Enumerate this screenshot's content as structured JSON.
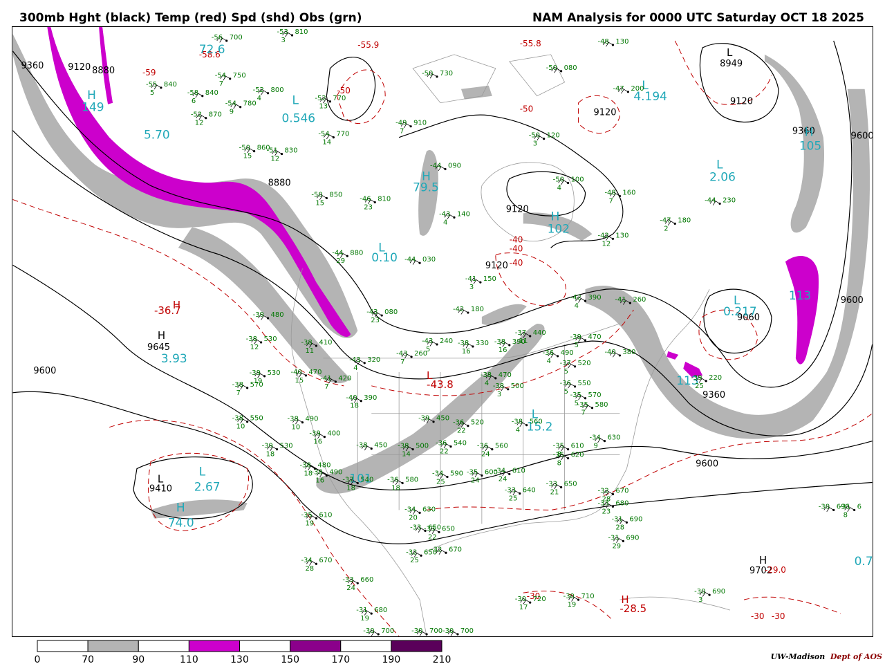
{
  "header": {
    "left_title": "300mb Hght (black) Temp (red) Spd (shd) Obs (grn)",
    "right_title": "NAM Analysis for 0000 UTC Saturday  OCT 18 2025"
  },
  "colors": {
    "height": "#000000",
    "temp": "#c00000",
    "obs": "#007700",
    "speed_label": "#20a8b8",
    "shade_70": "#b4b4b4",
    "shade_110": "#cc00cc",
    "shade_150": "#8b008b",
    "shade_190": "#5a005a",
    "coast": "#9a9a9a"
  },
  "legend": {
    "ticks": [
      "0",
      "70",
      "90",
      "110",
      "130",
      "150",
      "170",
      "190",
      "210"
    ],
    "segments": [
      {
        "from": "0",
        "to": "70",
        "color": "#ffffff"
      },
      {
        "from": "70",
        "to": "90",
        "color": "#b4b4b4"
      },
      {
        "from": "90",
        "to": "110",
        "color": "#ffffff"
      },
      {
        "from": "110",
        "to": "130",
        "color": "#cc00cc"
      },
      {
        "from": "130",
        "to": "150",
        "color": "#ffffff"
      },
      {
        "from": "150",
        "to": "170",
        "color": "#8b008b"
      },
      {
        "from": "170",
        "to": "190",
        "color": "#ffffff"
      },
      {
        "from": "190",
        "to": "210",
        "color": "#5a005a"
      }
    ]
  },
  "credit": {
    "part1": "UW-Madison",
    "part2": "Dept of AOS"
  },
  "height_labels": [
    "9360",
    "9120",
    "8880",
    "9120",
    "8880",
    "8949",
    "9120",
    "9360",
    "9600",
    "9120",
    "9120",
    "9360",
    "9060",
    "9360",
    "9600",
    "9645",
    "9600",
    "9410",
    "9600",
    "9702"
  ],
  "pressure_centers": [
    {
      "letter": "H",
      "value": "149",
      "kind": "speed"
    },
    {
      "letter": "L",
      "value": "0.546",
      "kind": "speed"
    },
    {
      "letter": "H",
      "value": "79.5",
      "kind": "speed"
    },
    {
      "letter": "L",
      "value": "0.10",
      "kind": "speed"
    },
    {
      "letter": "H",
      "value": "102",
      "kind": "speed"
    },
    {
      "letter": "L",
      "value": "2.06",
      "kind": "speed"
    },
    {
      "letter": "L",
      "value": "4.194",
      "kind": "speed"
    },
    {
      "letter": "H",
      "value": "105",
      "kind": "speed"
    },
    {
      "letter": "L",
      "value": "0.217",
      "kind": "speed"
    },
    {
      "letter": "H",
      "value": "113",
      "kind": "speed"
    },
    {
      "letter": "H",
      "value": "3.93",
      "kind": "speed"
    },
    {
      "letter": "L",
      "value": "2.67",
      "kind": "speed"
    },
    {
      "letter": "H",
      "value": "74.0",
      "kind": "speed"
    },
    {
      "letter": "H",
      "value": "101",
      "kind": "speed"
    },
    {
      "letter": "L",
      "value": "15.2",
      "kind": "speed"
    },
    {
      "letter": "H",
      "value": "-36.7",
      "kind": "temp"
    },
    {
      "letter": "L",
      "value": "-43.8",
      "kind": "temp"
    },
    {
      "letter": "H",
      "value": "-28.5",
      "kind": "temp"
    },
    {
      "letter": "H",
      "value": "",
      "kind": "height"
    },
    {
      "letter": "L",
      "value": "",
      "kind": "height"
    }
  ],
  "temp_labels": [
    "-58.6",
    "-55.9",
    "-55.8",
    "-59",
    "-50",
    "-50",
    "-40",
    "-40",
    "-40",
    "-30",
    "-30",
    "-30",
    "-29.0",
    "-50",
    "-40"
  ],
  "obs": [
    {
      "t": "-53",
      "h": "810",
      "d": "3"
    },
    {
      "t": "-56",
      "h": "700",
      "d": ""
    },
    {
      "t": "-54",
      "h": "750",
      "d": "7"
    },
    {
      "t": "-55",
      "h": "840",
      "d": "5"
    },
    {
      "t": "-58",
      "h": "840",
      "d": "6"
    },
    {
      "t": "-52",
      "h": "800",
      "d": "4"
    },
    {
      "t": "-54",
      "h": "780",
      "d": "9"
    },
    {
      "t": "-52",
      "h": "870",
      "d": "12"
    },
    {
      "t": "-52",
      "h": "770",
      "d": "13"
    },
    {
      "t": "-54",
      "h": "770",
      "d": "14"
    },
    {
      "t": "-49",
      "h": "910",
      "d": "7"
    },
    {
      "t": "-50",
      "h": "730",
      "d": ""
    },
    {
      "t": "-50",
      "h": "080",
      "d": ""
    },
    {
      "t": "-48",
      "h": "130",
      "d": ""
    },
    {
      "t": "-47",
      "h": "200",
      "d": ""
    },
    {
      "t": "-50",
      "h": "860",
      "d": "15"
    },
    {
      "t": "-51",
      "h": "830",
      "d": "12"
    },
    {
      "t": "-44",
      "h": "090",
      "d": ""
    },
    {
      "t": "-50",
      "h": "120",
      "d": "3"
    },
    {
      "t": "-50",
      "h": "100",
      "d": "4"
    },
    {
      "t": "-48",
      "h": "160",
      "d": "7"
    },
    {
      "t": "-44",
      "h": "230",
      "d": ""
    },
    {
      "t": "-50",
      "h": "850",
      "d": "15"
    },
    {
      "t": "-46",
      "h": "810",
      "d": "23"
    },
    {
      "t": "-43",
      "h": "140",
      "d": "4"
    },
    {
      "t": "-47",
      "h": "180",
      "d": "2"
    },
    {
      "t": "-42",
      "h": "130",
      "d": "12"
    },
    {
      "t": "-44",
      "h": "880",
      "d": "29"
    },
    {
      "t": "-44",
      "h": "030",
      "d": ""
    },
    {
      "t": "-41",
      "h": "150",
      "d": "3"
    },
    {
      "t": "-42",
      "h": "180",
      "d": ""
    },
    {
      "t": "-41",
      "h": "260",
      "d": ""
    },
    {
      "t": "-42",
      "h": "390",
      "d": "4"
    },
    {
      "t": "-43",
      "h": "080",
      "d": "23"
    },
    {
      "t": "-43",
      "h": "240",
      "d": "5"
    },
    {
      "t": "-38",
      "h": "330",
      "d": "16"
    },
    {
      "t": "-38",
      "h": "390",
      "d": "16"
    },
    {
      "t": "-37",
      "h": "440",
      "d": "11"
    },
    {
      "t": "-39",
      "h": "470",
      "d": "5"
    },
    {
      "t": "-39",
      "h": "480",
      "d": ""
    },
    {
      "t": "-38",
      "h": "530",
      "d": "12"
    },
    {
      "t": "-38",
      "h": "410",
      "d": "11"
    },
    {
      "t": "-43",
      "h": "320",
      "d": "4"
    },
    {
      "t": "-43",
      "h": "260",
      "d": "7"
    },
    {
      "t": "-39",
      "h": "530",
      "d": "19"
    },
    {
      "t": "-40",
      "h": "470",
      "d": "15"
    },
    {
      "t": "-41",
      "h": "420",
      "d": "7"
    },
    {
      "t": "-38",
      "h": "570",
      "d": "7"
    },
    {
      "t": "-40",
      "h": "390",
      "d": "18"
    },
    {
      "t": "-38",
      "h": "470",
      "d": "4"
    },
    {
      "t": "-38",
      "h": "500",
      "d": "3"
    },
    {
      "t": "-36",
      "h": "490",
      "d": "4"
    },
    {
      "t": "-37",
      "h": "520",
      "d": "5"
    },
    {
      "t": "-36",
      "h": "550",
      "d": "5"
    },
    {
      "t": "-35",
      "h": "570",
      "d": "5"
    },
    {
      "t": "-35",
      "h": "580",
      "d": "7"
    },
    {
      "t": "-38",
      "h": "550",
      "d": "10"
    },
    {
      "t": "-38",
      "h": "490",
      "d": "10"
    },
    {
      "t": "-39",
      "h": "400",
      "d": "16"
    },
    {
      "t": "-38",
      "h": "480",
      "d": "18"
    },
    {
      "t": "-39",
      "h": "450",
      "d": ""
    },
    {
      "t": "-36",
      "h": "520",
      "d": "22"
    },
    {
      "t": "-38",
      "h": "560",
      "d": "4"
    },
    {
      "t": "-39",
      "h": "530",
      "d": "18"
    },
    {
      "t": "-38",
      "h": "450",
      "d": ""
    },
    {
      "t": "-38",
      "h": "500",
      "d": "14"
    },
    {
      "t": "-36",
      "h": "540",
      "d": "22"
    },
    {
      "t": "-36",
      "h": "560",
      "d": "24"
    },
    {
      "t": "-35",
      "h": "610",
      "d": "8"
    },
    {
      "t": "-35",
      "h": "620",
      "d": "8"
    },
    {
      "t": "-34",
      "h": "630",
      "d": "9"
    },
    {
      "t": "-38",
      "h": "490",
      "d": "16"
    },
    {
      "t": "-37",
      "h": "540",
      "d": "18"
    },
    {
      "t": "-36",
      "h": "580",
      "d": "18"
    },
    {
      "t": "-34",
      "h": "590",
      "d": "25"
    },
    {
      "t": "-35",
      "h": "600",
      "d": "24"
    },
    {
      "t": "-34",
      "h": "610",
      "d": "24"
    },
    {
      "t": "-33",
      "h": "650",
      "d": "21"
    },
    {
      "t": "-33",
      "h": "640",
      "d": "25"
    },
    {
      "t": "-33",
      "h": "650",
      "d": ""
    },
    {
      "t": "-32",
      "h": "670",
      "d": "28"
    },
    {
      "t": "-33",
      "h": "680",
      "d": "23"
    },
    {
      "t": "-31",
      "h": "690",
      "d": "28"
    },
    {
      "t": "-31",
      "h": "690",
      "d": "29"
    },
    {
      "t": "-35",
      "h": "610",
      "d": "19"
    },
    {
      "t": "-34",
      "h": "630",
      "d": "20"
    },
    {
      "t": "-33",
      "h": "650",
      "d": "22"
    },
    {
      "t": "-32",
      "h": "650",
      "d": "25"
    },
    {
      "t": "-32",
      "h": "670",
      "d": ""
    },
    {
      "t": "-34",
      "h": "670",
      "d": "28"
    },
    {
      "t": "-33",
      "h": "660",
      "d": "24"
    },
    {
      "t": "-31",
      "h": "680",
      "d": "19"
    },
    {
      "t": "-30",
      "h": "700",
      "d": "23"
    },
    {
      "t": "-30",
      "h": "700",
      "d": ""
    },
    {
      "t": "-30",
      "h": "700",
      "d": ""
    },
    {
      "t": "-30",
      "h": "720",
      "d": "17"
    },
    {
      "t": "-30",
      "h": "710",
      "d": "19"
    },
    {
      "t": "-30",
      "h": "690",
      "d": "3"
    },
    {
      "t": "-30",
      "h": "690",
      "d": ""
    },
    {
      "t": "-31",
      "h": "6",
      "d": "8"
    },
    {
      "t": "-39",
      "h": "220",
      "d": "25"
    },
    {
      "t": "-40",
      "h": "380",
      "d": ""
    }
  ]
}
